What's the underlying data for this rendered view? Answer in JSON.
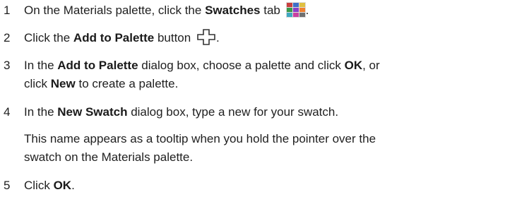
{
  "steps": [
    {
      "num": "1",
      "t1": "On the Materials palette, click the ",
      "b1": "Swatches",
      "t2": " tab ",
      "icon": "swatches-tab-icon",
      "t3": "."
    },
    {
      "num": "2",
      "t1": "Click the ",
      "b1": "Add to Palette",
      "t2": " button ",
      "icon": "add-to-palette-icon",
      "t3": "."
    },
    {
      "num": "3",
      "t1": "In the ",
      "b1": "Add to Palette",
      "t2": " dialog box, choose a palette and click ",
      "b2": "OK",
      "t3": ", or",
      "line2_t1": "click ",
      "line2_b1": "New",
      "line2_t2": " to create a palette."
    },
    {
      "num": "4",
      "t1": "In the ",
      "b1": "New Swatch",
      "t2": " dialog box, type a new for your swatch.",
      "note_line1": "This name appears as a tooltip when you hold the pointer over the",
      "note_line2": "swatch on the Materials palette."
    },
    {
      "num": "5",
      "t1": "Click ",
      "b1": "OK",
      "t2": "."
    }
  ],
  "icons": {
    "swatches_colors": [
      "#c83f3f",
      "#3f6fc8",
      "#e0c040",
      "#3a9a4a",
      "#8a3fc8",
      "#f08030",
      "#40a8c0",
      "#c840a0",
      "#707070"
    ]
  }
}
